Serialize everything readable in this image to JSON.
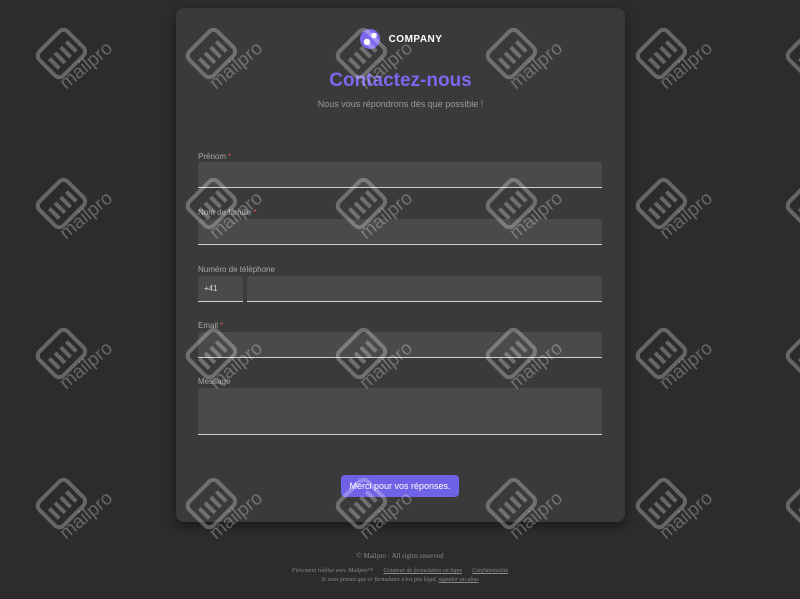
{
  "logo": {
    "text": "COMPANY"
  },
  "form": {
    "title": "Contactez-nous",
    "subtitle": "Nous vous répondrons dès que possible !",
    "fields": {
      "firstname": {
        "label": "Prénom",
        "required_mark": "*",
        "value": ""
      },
      "lastname": {
        "label": "Nom de famille",
        "required_mark": "*",
        "value": ""
      },
      "phone": {
        "label": "Numéro de téléphone",
        "prefix": "+41",
        "value": ""
      },
      "email": {
        "label": "Email",
        "required_mark": "*",
        "value": ""
      },
      "message": {
        "label": "Message",
        "value": ""
      }
    },
    "submit_label": "Merci pour vos réponses."
  },
  "footer": {
    "copyright": "© Mailpro · All rights reserved",
    "made_with": "Fièrement réalisé avec Mailpro™",
    "builder_link": "Créateur de formulaires en ligne",
    "privacy_link": "Confidentialité",
    "abuse_text": "Si vous pensez que ce formulaire n'est pas légal,",
    "abuse_link": "signaler un abus"
  },
  "watermark": {
    "text": "mailpro"
  },
  "colors": {
    "accent": "#7b68ee",
    "button": "#6f62e6",
    "background": "#2c2c2c",
    "card": "#3a3a3a",
    "required": "#e05050"
  }
}
